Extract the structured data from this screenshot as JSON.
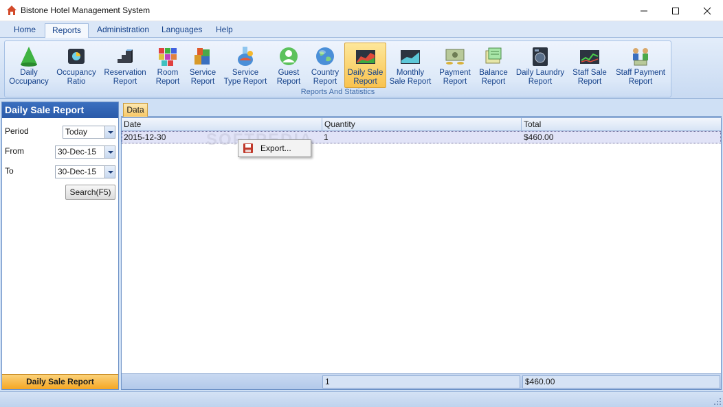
{
  "window": {
    "title": "Bistone Hotel Management System"
  },
  "menu": [
    "Home",
    "Reports",
    "Administration",
    "Languages",
    "Help"
  ],
  "ribbon": {
    "group_label": "Reports And Statistics",
    "buttons": [
      {
        "label": "Daily\nOccupancy",
        "icon": "cone-icon"
      },
      {
        "label": "Occupancy\nRatio",
        "icon": "pie-chart-icon"
      },
      {
        "label": "Reservation\nReport",
        "icon": "stairs-icon"
      },
      {
        "label": "Room\nReport",
        "icon": "cubes-icon"
      },
      {
        "label": "Service\nReport",
        "icon": "blocks-icon"
      },
      {
        "label": "Service\nType Report",
        "icon": "flask-icon"
      },
      {
        "label": "Guest\nReport",
        "icon": "user-icon"
      },
      {
        "label": "Country\nReport",
        "icon": "globe-icon"
      },
      {
        "label": "Daily Sale\nReport",
        "icon": "area-chart-icon"
      },
      {
        "label": "Monthly\nSale Report",
        "icon": "line-chart-icon"
      },
      {
        "label": "Payment\nReport",
        "icon": "money-icon"
      },
      {
        "label": "Balance\nReport",
        "icon": "balance-icon"
      },
      {
        "label": "Daily Laundry\nReport",
        "icon": "washer-icon"
      },
      {
        "label": "Staff Sale\nReport",
        "icon": "stock-chart-icon"
      },
      {
        "label": "Staff Payment\nReport",
        "icon": "staff-money-icon"
      }
    ]
  },
  "left_panel": {
    "title": "Daily Sale Report",
    "period_label": "Period",
    "period_value": "Today",
    "from_label": "From",
    "from_value": "30-Dec-15",
    "to_label": "To",
    "to_value": "30-Dec-15",
    "search_label": "Search(F5)",
    "footer_label": "Daily Sale Report"
  },
  "main": {
    "tab_label": "Data",
    "columns": [
      "Date",
      "Quantity",
      "Total"
    ],
    "rows": [
      {
        "date": "2015-12-30",
        "quantity": "1",
        "total": "$460.00"
      }
    ],
    "footer": {
      "quantity": "1",
      "total": "$460.00"
    }
  },
  "context_menu": {
    "items": [
      {
        "label": "Export...",
        "icon": "save-icon"
      }
    ]
  },
  "watermark": "SOFTPEDIA",
  "colors": {
    "accent": "#2a5aa9",
    "active_button": "#f9c34f",
    "selected_row": "#e1e3f7"
  }
}
